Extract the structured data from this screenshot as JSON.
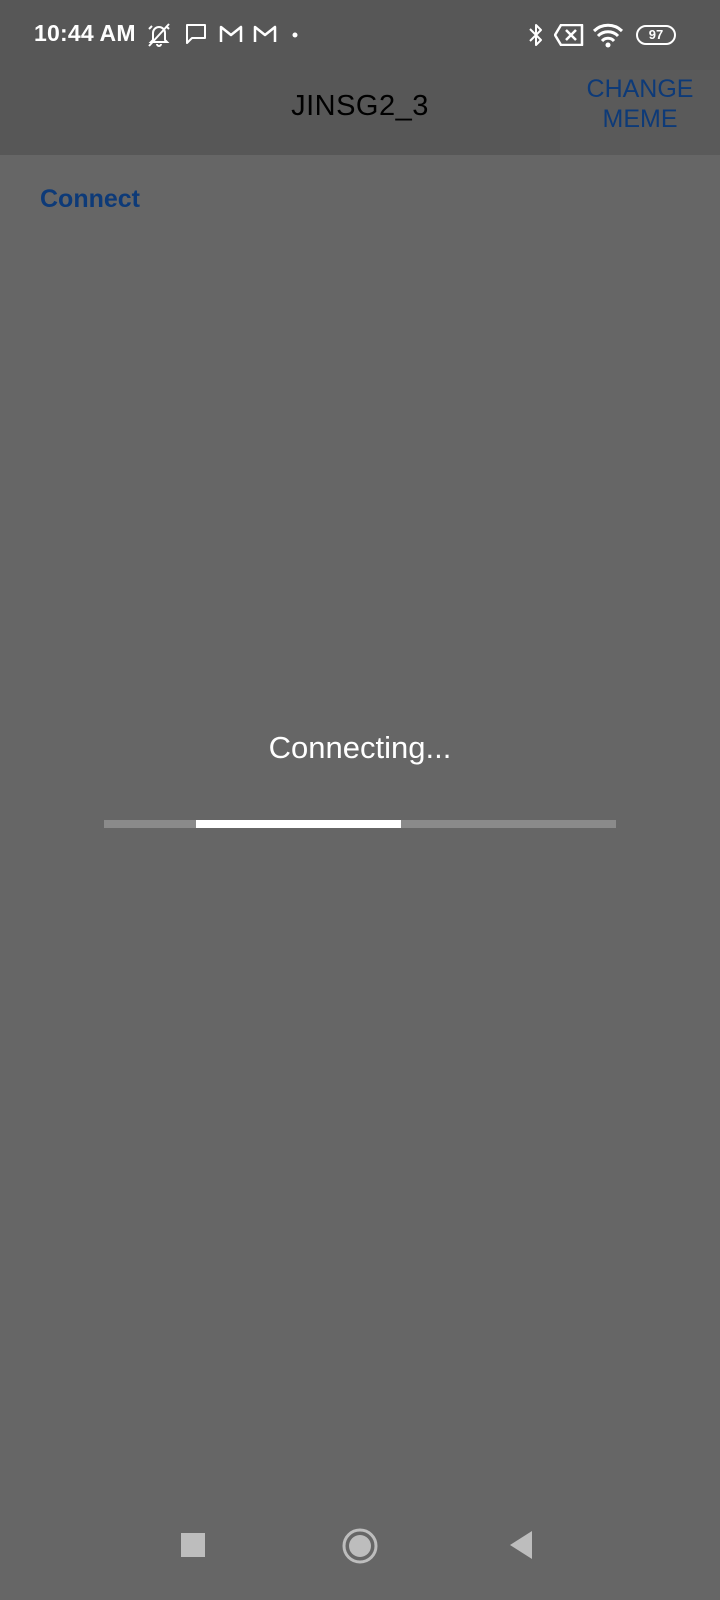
{
  "status_bar": {
    "time": "10:44 AM",
    "battery_level": "97",
    "icons": [
      "alarm-off-icon",
      "message-icon",
      "gmail-icon",
      "gmail-icon",
      "dot-icon",
      "bluetooth-icon",
      "no-sim-icon",
      "wifi-icon",
      "battery-icon"
    ]
  },
  "app_bar": {
    "title": "JINSG2_3",
    "change_meme_line1": "CHANGE",
    "change_meme_line2": "MEME"
  },
  "main": {
    "connect_label": "Connect",
    "connecting_text": "Connecting...",
    "progress": {
      "indeterminate": true,
      "segment_start": 0.18,
      "segment_end": 0.58
    }
  },
  "nav_bar": {
    "icons": [
      "recents-icon",
      "home-icon",
      "back-icon"
    ]
  },
  "colors": {
    "background": "#666666",
    "bar_background": "#575757",
    "accent_blue": "#0d3a78",
    "text_white": "#ffffff"
  }
}
